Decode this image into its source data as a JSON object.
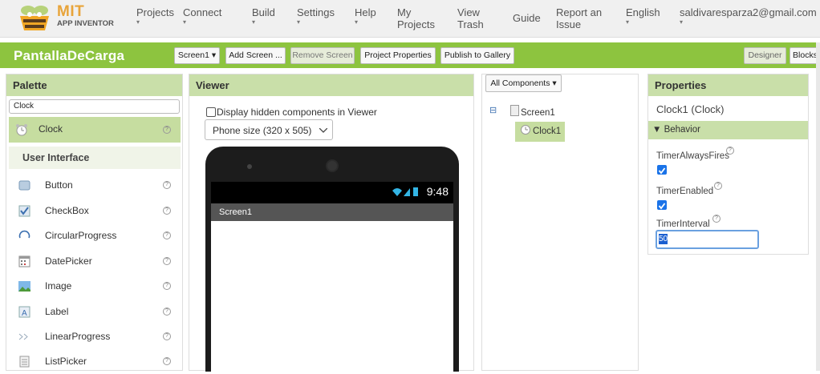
{
  "nav": {
    "logo_line1": "MIT",
    "logo_line2": "APP INVENTOR",
    "projects": "Projects",
    "connect": "Connect",
    "build": "Build",
    "settings": "Settings",
    "help": "Help",
    "my_projects_1": "My",
    "my_projects_2": "Projects",
    "view_trash_1": "View",
    "view_trash_2": "Trash",
    "guide": "Guide",
    "report_1": "Report an",
    "report_2": "Issue",
    "language": "English",
    "account": "saldivaresparza2@gmail.com",
    "caret": "▾"
  },
  "toolbar": {
    "project_name": "PantallaDeCarga",
    "screen_select": "Screen1 ▾",
    "add_screen": "Add Screen ...",
    "remove_screen": "Remove Screen",
    "project_properties": "Project Properties",
    "publish": "Publish to Gallery",
    "designer": "Designer",
    "blocks": "Blocks"
  },
  "palette": {
    "title": "Palette",
    "search_value": "Clock",
    "result": "Clock",
    "category": "User Interface",
    "items": [
      {
        "label": "Button",
        "icon": "button-icon"
      },
      {
        "label": "CheckBox",
        "icon": "checkbox-icon"
      },
      {
        "label": "CircularProgress",
        "icon": "circular-progress-icon"
      },
      {
        "label": "DatePicker",
        "icon": "datepicker-icon"
      },
      {
        "label": "Image",
        "icon": "image-icon"
      },
      {
        "label": "Label",
        "icon": "label-icon"
      },
      {
        "label": "LinearProgress",
        "icon": "linear-progress-icon"
      },
      {
        "label": "ListPicker",
        "icon": "listpicker-icon"
      }
    ],
    "help_glyph": "?"
  },
  "viewer": {
    "title": "Viewer",
    "hidden_checkbox_label": "Display hidden components in Viewer",
    "phone_size": "Phone size (320 x 505)",
    "time": "9:48",
    "screen_title": "Screen1"
  },
  "components": {
    "filter": "All Components ▾",
    "root": "Screen1",
    "child": "Clock1",
    "collapse_glyph": "⊟"
  },
  "properties": {
    "title": "Properties",
    "component": "Clock1 (Clock)",
    "section": "▼ Behavior",
    "timer_always_fires": "TimerAlwaysFires",
    "timer_enabled": "TimerEnabled",
    "timer_interval": "TimerInterval",
    "timer_interval_value": "50",
    "help_glyph": "?"
  },
  "colors": {
    "accent_green": "#8dc43f",
    "panel_header": "#c9dfa9",
    "selected_row": "#c6dda0",
    "checkbox_blue": "#1a73e8"
  }
}
